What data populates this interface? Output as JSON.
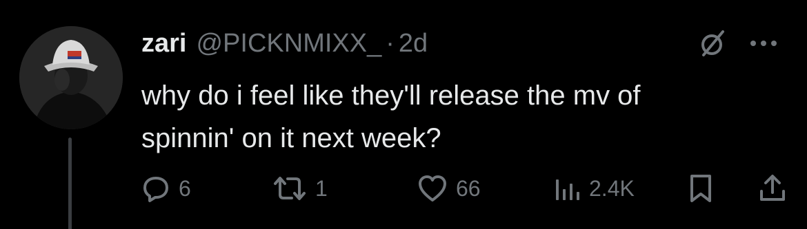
{
  "tweet": {
    "display_name": "zari",
    "handle": "@PICKNMIXX_",
    "separator": "·",
    "time": "2d",
    "text_line1": "why do i feel like they'll release the mv of",
    "text_line2": "spinnin' on it next week?"
  },
  "actions": {
    "reply_count": "6",
    "retweet_count": "1",
    "like_count": "66",
    "views_count": "2.4K"
  },
  "icons": {
    "header": [
      "grok-icon",
      "more-icon"
    ],
    "actions": [
      "reply-icon",
      "retweet-icon",
      "like-icon",
      "views-icon",
      "bookmark-icon",
      "share-icon"
    ]
  },
  "colors": {
    "background": "#000000",
    "primary_text": "#e7e9ea",
    "secondary_text": "#71767b"
  }
}
